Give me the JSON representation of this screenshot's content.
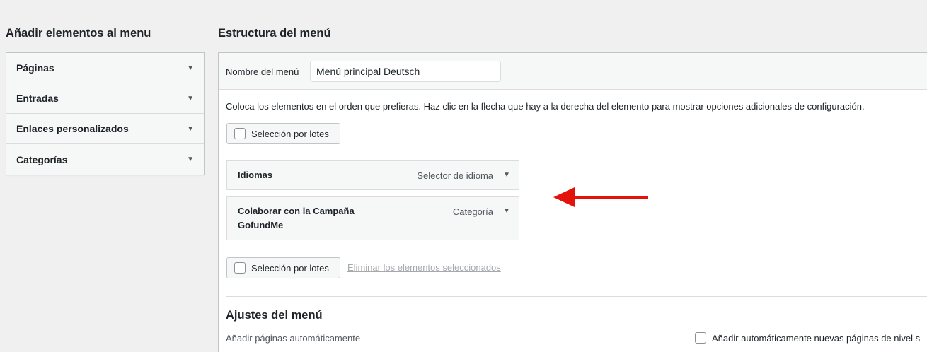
{
  "left": {
    "title": "Añadir elementos al menu",
    "items": [
      {
        "label": "Páginas"
      },
      {
        "label": "Entradas"
      },
      {
        "label": "Enlaces personalizados"
      },
      {
        "label": "Categorías"
      }
    ]
  },
  "right": {
    "title": "Estructura del menú",
    "name_label": "Nombre del menú",
    "name_value": "Menú principal Deutsch",
    "instructions": "Coloca los elementos en el orden que prefieras. Haz clic en la flecha que hay a la derecha del elemento para mostrar opciones adicionales de configuración.",
    "bulk_select_label": "Selección por lotes",
    "menu_items": [
      {
        "title": "Idiomas",
        "type": "Selector de idioma"
      },
      {
        "title_line1": "Colaborar con la Campaña",
        "title_line2": "GofundMe",
        "type": "Categoría"
      }
    ],
    "delete_label": "Eliminar los elementos seleccionados",
    "settings_title": "Ajustes del menú",
    "auto_add_label": "Añadir páginas automáticamente",
    "auto_add_checkbox_label": "Añadir automáticamente nuevas páginas de nivel s"
  },
  "colors": {
    "background": "#f0f0f1",
    "arrow": "#e3120b",
    "border": "#c3c4c7"
  }
}
